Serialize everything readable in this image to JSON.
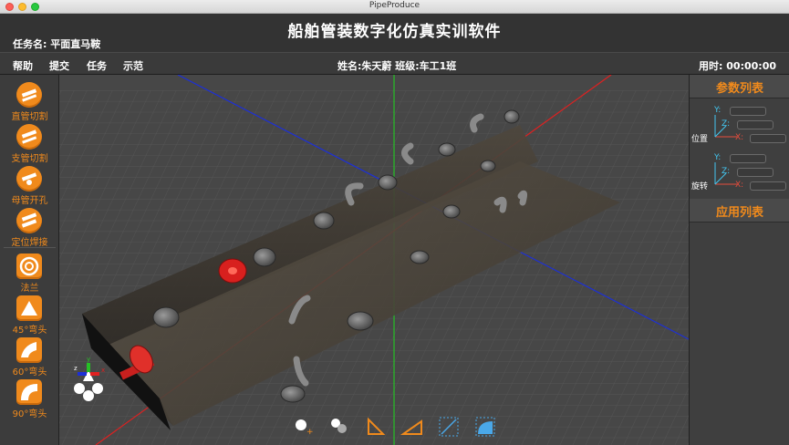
{
  "window": {
    "title": "PipeProduce"
  },
  "header": {
    "app_title": "船舶管装数字化仿真实训软件",
    "task_label": "任务名: 平面直马鞍"
  },
  "menu": {
    "items": [
      "帮助",
      "提交",
      "任务",
      "示范"
    ],
    "student_info": "姓名:朱天蔚  班级:车工1班",
    "timer": "用时: 00:00:00"
  },
  "tools": [
    {
      "label": "直管切割",
      "icon": "pipe-cut-icon",
      "shape": "round"
    },
    {
      "label": "支管切割",
      "icon": "branch-cut-icon",
      "shape": "round"
    },
    {
      "label": "母管开孔",
      "icon": "main-pipe-drill-icon",
      "shape": "round"
    },
    {
      "label": "定位焊接",
      "icon": "weld-icon",
      "shape": "round"
    },
    {
      "label": "法兰",
      "icon": "flange-icon",
      "shape": "sq"
    },
    {
      "label": "45°弯头",
      "icon": "elbow-45-icon",
      "shape": "sq"
    },
    {
      "label": "60°弯头",
      "icon": "elbow-60-icon",
      "shape": "sq"
    },
    {
      "label": "90°弯头",
      "icon": "elbow-90-icon",
      "shape": "sq"
    }
  ],
  "right_panel": {
    "params_title": "参数列表",
    "position_label": "位置",
    "rotation_label": "旋转",
    "apply_title": "应用列表",
    "axes": {
      "y": "Y:",
      "z": "Z:",
      "x": "X:"
    }
  },
  "colors": {
    "accent": "#f08a1c",
    "axis_red": "#e02020",
    "axis_blue": "#1c2fd8",
    "axis_green": "#25c025"
  },
  "bottom_tools": [
    "add-point-icon",
    "points-icon",
    "angle-ruler-icon",
    "triangle-ruler-icon",
    "select-region-icon",
    "fill-region-icon"
  ]
}
